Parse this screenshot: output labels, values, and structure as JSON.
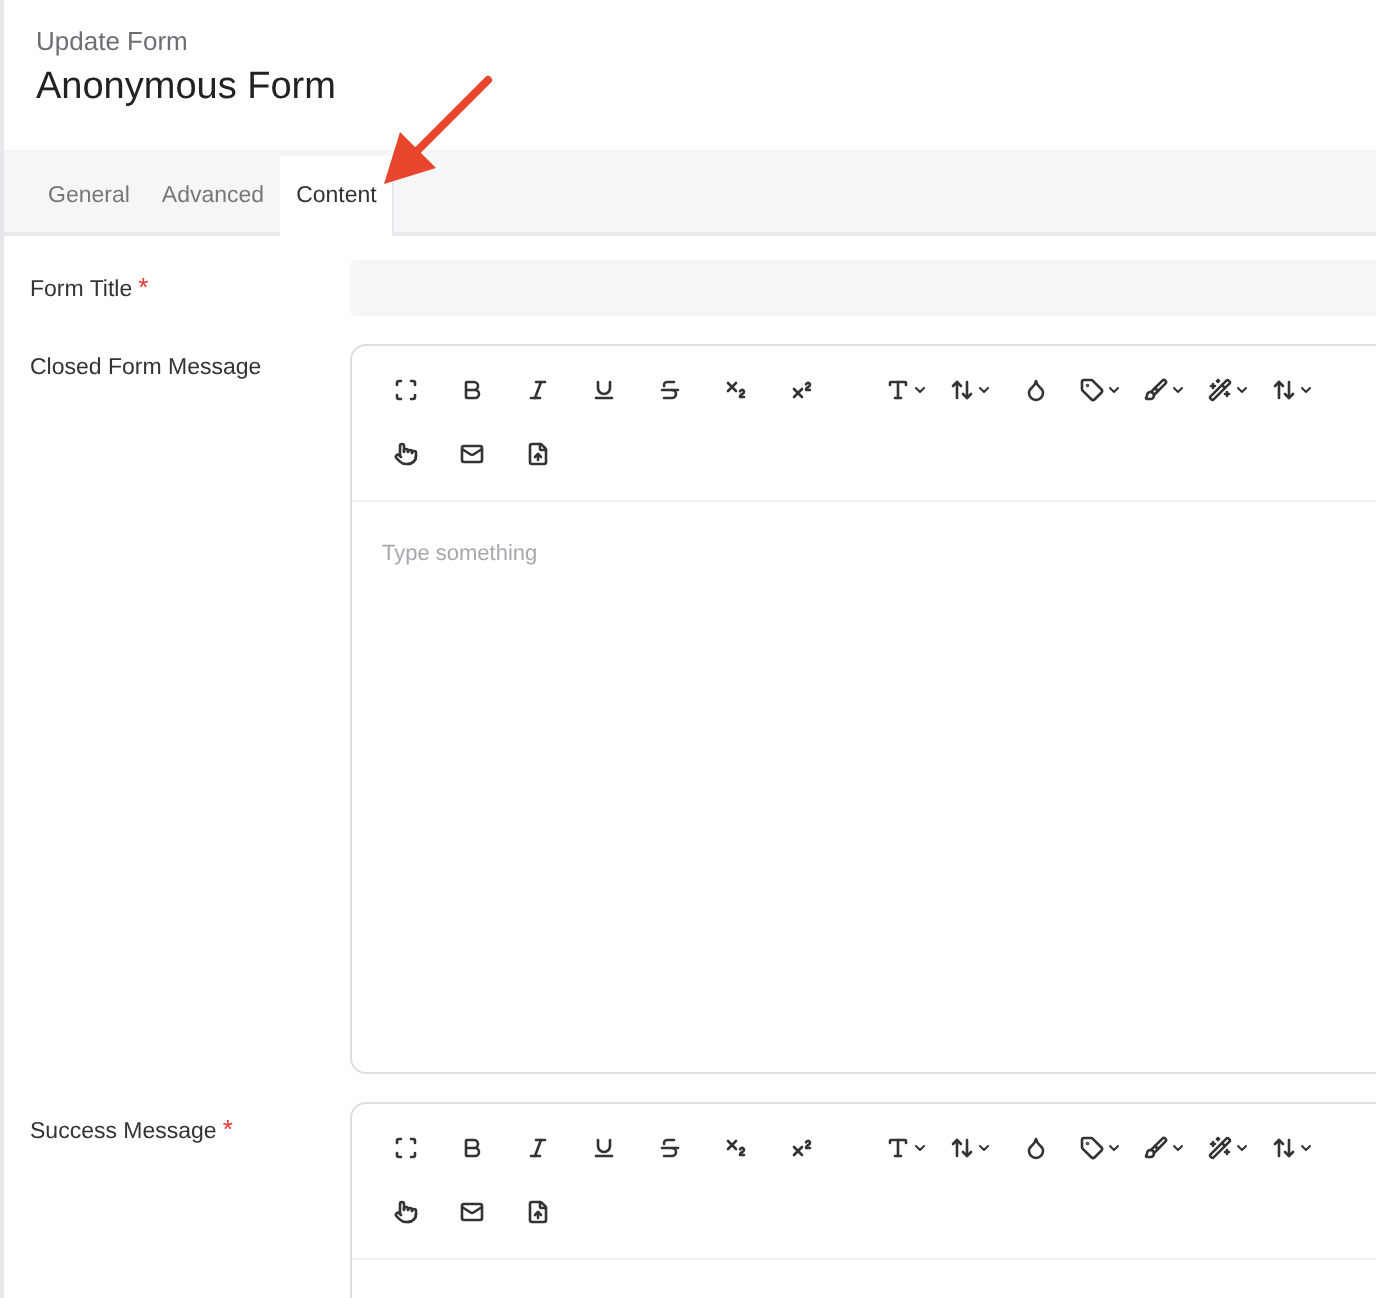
{
  "header": {
    "subtitle": "Update Form",
    "title": "Anonymous Form"
  },
  "tabs": [
    {
      "label": "General",
      "selected": false
    },
    {
      "label": "Advanced",
      "selected": false
    },
    {
      "label": "Content",
      "selected": true
    }
  ],
  "fields": [
    {
      "kind": "input",
      "label": "Form Title",
      "required_mark": "*"
    },
    {
      "kind": "editor",
      "label": "Closed Form Message",
      "placeholder": "Type something"
    },
    {
      "kind": "editor",
      "label": "Success Message",
      "required_mark": "*"
    }
  ]
}
